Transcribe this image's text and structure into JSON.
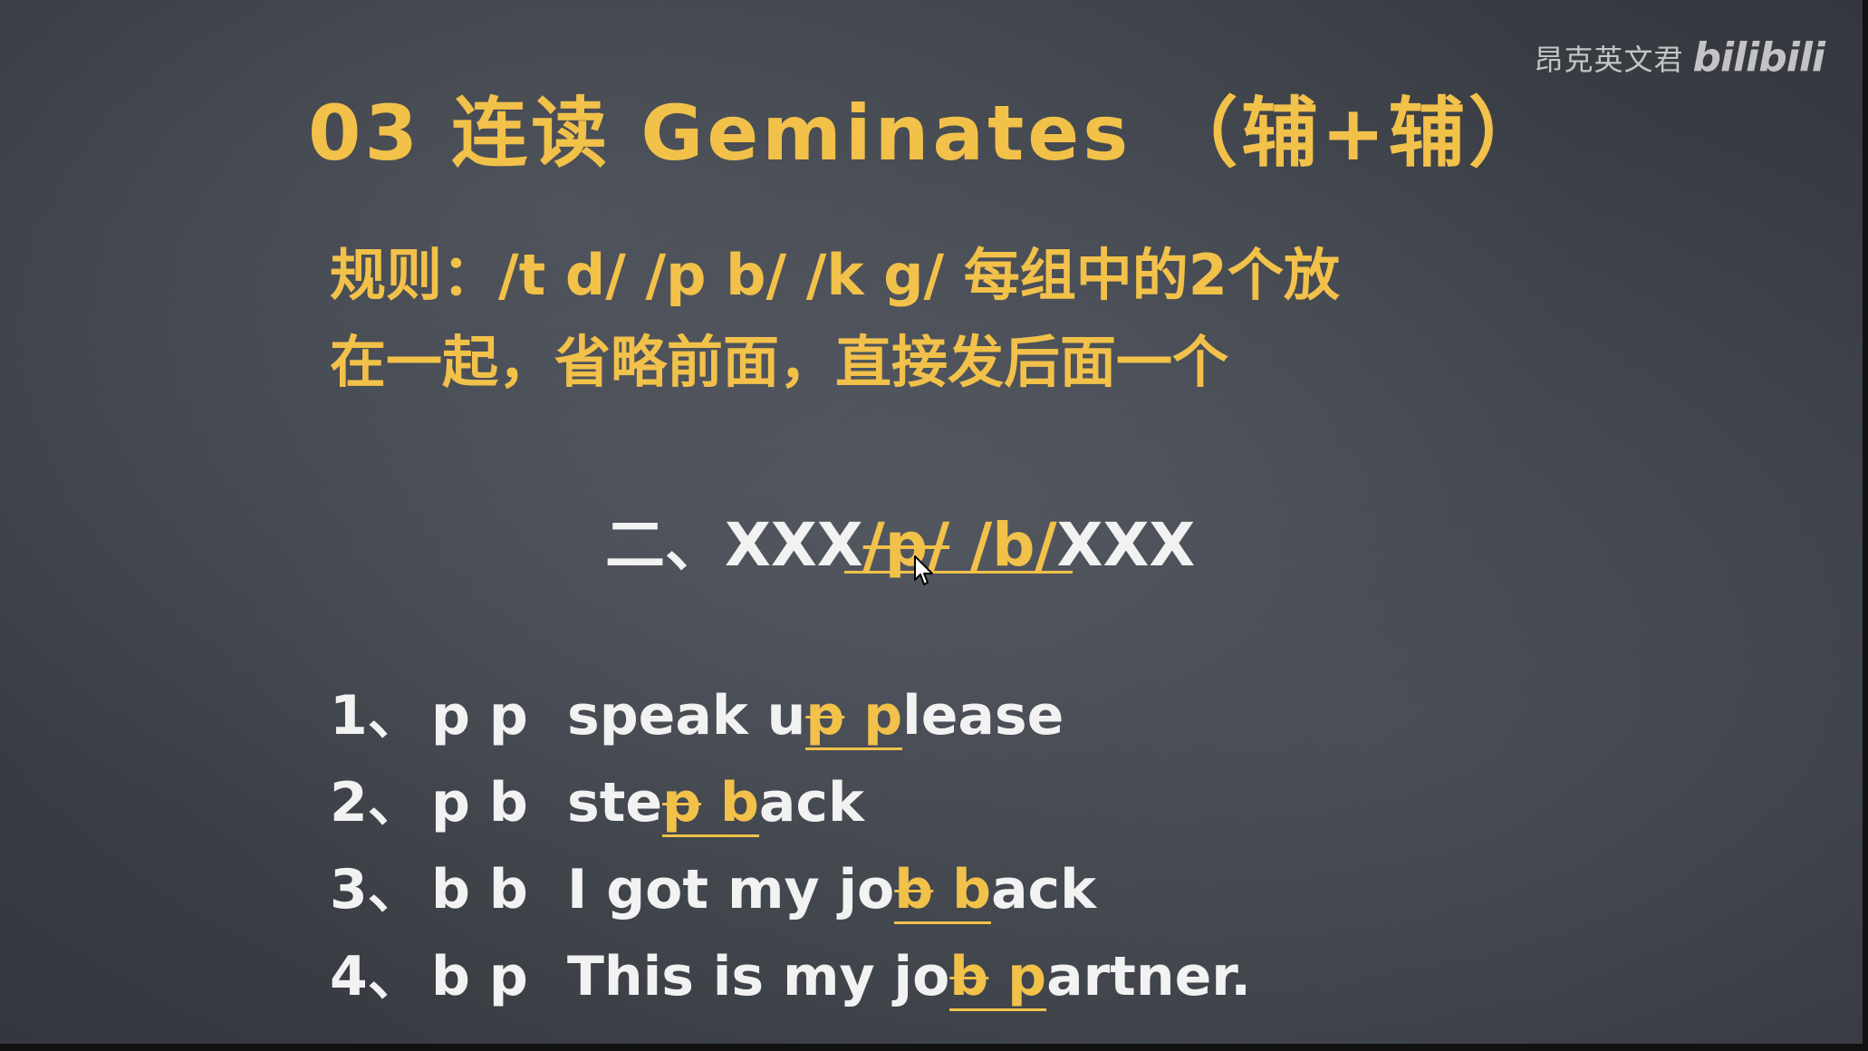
{
  "watermark": {
    "author": "昂克英文君",
    "logo": "bilibili"
  },
  "slide": {
    "title": "03 连读 Geminates （辅+辅）",
    "rule_line1": "规则：/t d/ /p b/ /k g/ 每组中的2个放",
    "rule_line2": "在一起，省略前面，直接发后面一个",
    "pattern": {
      "prefix": "二、XXX",
      "struck": "/p/",
      "kept": " /b/",
      "suffix": "XXX"
    },
    "examples": [
      {
        "num": "1、",
        "pair": "p p",
        "before": "speak u",
        "struck": "p",
        "gap": " ",
        "kept": "p",
        "after": "lease"
      },
      {
        "num": "2、",
        "pair": "p b",
        "before": "ste",
        "struck": "p",
        "gap": " ",
        "kept": "b",
        "after": "ack"
      },
      {
        "num": "3、",
        "pair": "b b",
        "before": "I got my jo",
        "struck": "b",
        "gap": " ",
        "kept": "b",
        "after": "ack"
      },
      {
        "num": "4、",
        "pair": "b p",
        "before": "This is my jo",
        "struck": "b",
        "gap": " ",
        "kept": "p",
        "after": "artner."
      }
    ]
  },
  "colors": {
    "chalk_yellow": "#f2c14a",
    "chalk_white": "#f2f2f2",
    "board": "#3d4148"
  },
  "icons": {
    "cursor": "mouse-pointer-icon"
  }
}
